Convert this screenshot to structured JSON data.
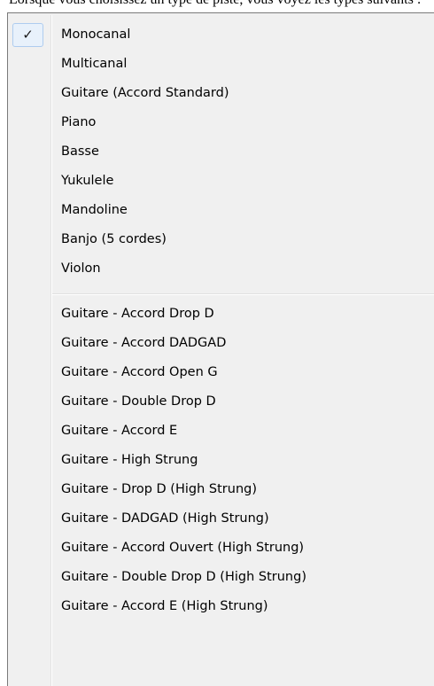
{
  "menu": {
    "top_label": "Lorsque vous choisissez un type de piste, vous voyez les types suivants :",
    "check_mark": "✓",
    "group1": [
      {
        "label": "Monocanal",
        "checked": true
      },
      {
        "label": "Multicanal"
      },
      {
        "label": "Guitare (Accord Standard)"
      },
      {
        "label": "Piano"
      },
      {
        "label": "Basse"
      },
      {
        "label": "Yukulele"
      },
      {
        "label": "Mandoline"
      },
      {
        "label": "Banjo (5 cordes)"
      },
      {
        "label": "Violon"
      }
    ],
    "group2": [
      {
        "label": "Guitare - Accord Drop D"
      },
      {
        "label": "Guitare - Accord DADGAD"
      },
      {
        "label": "Guitare - Accord Open G"
      },
      {
        "label": "Guitare - Double Drop D"
      },
      {
        "label": "Guitare - Accord E"
      },
      {
        "label": "Guitare - High Strung"
      },
      {
        "label": "Guitare - Drop D (High Strung)"
      },
      {
        "label": "Guitare - DADGAD (High Strung)"
      },
      {
        "label": "Guitare - Accord Ouvert (High Strung)"
      },
      {
        "label": "Guitare - Double Drop D (High Strung)"
      },
      {
        "label": "Guitare - Accord E (High Strung)"
      }
    ]
  }
}
